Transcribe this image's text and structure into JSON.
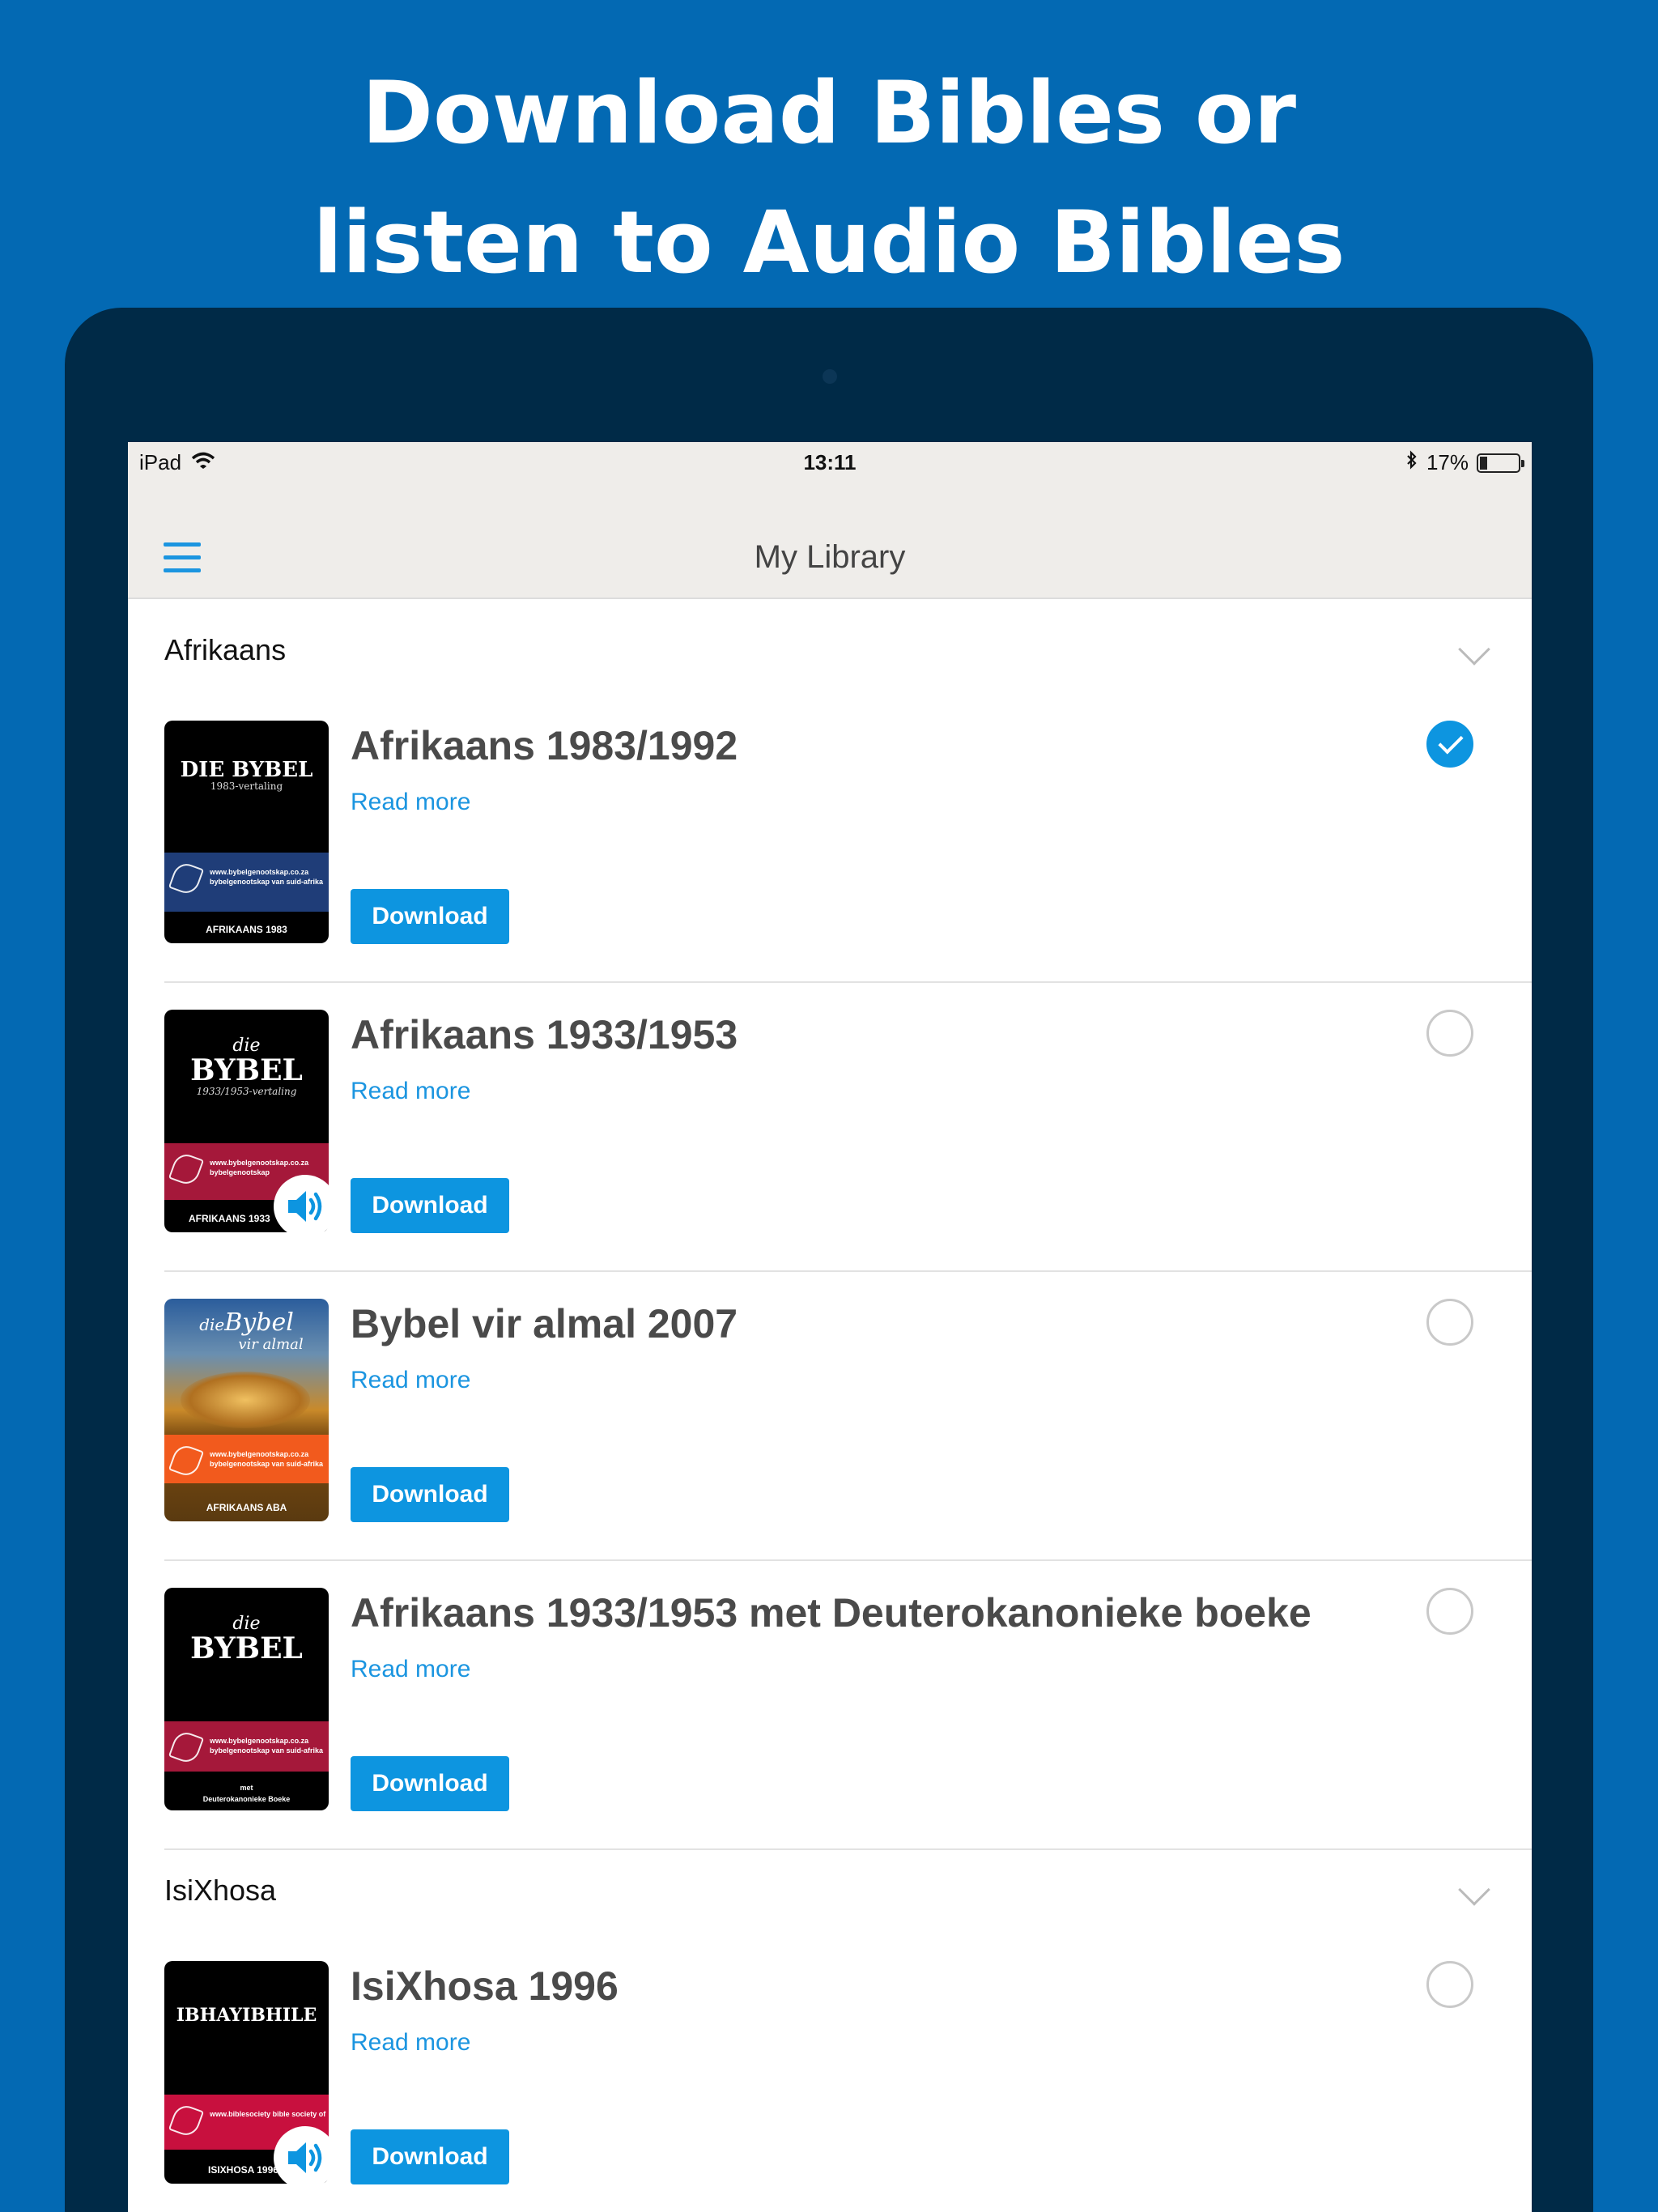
{
  "headline": {
    "line1": "Download Bibles or",
    "line2": "listen to Audio Bibles"
  },
  "status": {
    "device": "iPad",
    "time": "13:11",
    "battery": "17%",
    "battery_level": 0.17
  },
  "nav": {
    "title": "My Library"
  },
  "sections": [
    {
      "name": "Afrikaans",
      "items": [
        {
          "title": "Afrikaans 1983/1992",
          "read_more": "Read more",
          "download": "Download",
          "selected": true,
          "audio": false,
          "cover": {
            "title": "DIE BYBEL",
            "subtitle": "1983-vertaling",
            "url": "www.bybelgenootskap.co.za bybelgenootskap van suid-afrika",
            "label": "AFRIKAANS 1983",
            "band_color": "#1f3d78"
          }
        },
        {
          "title": "Afrikaans 1933/1953",
          "read_more": "Read more",
          "download": "Download",
          "selected": false,
          "audio": true,
          "cover": {
            "title_small": "die",
            "title": "BYBEL",
            "subtitle": "1933/1953-vertaling",
            "url": "www.bybelgenootskap.co.za bybelgenootskap",
            "label": "AFRIKAANS 1933",
            "band_color": "#a5183a"
          }
        },
        {
          "title": "Bybel vir almal 2007",
          "read_more": "Read more",
          "download": "Download",
          "selected": false,
          "audio": false,
          "cover": {
            "title_small": "die",
            "title": "Bybel",
            "subtitle": "vir almal",
            "url": "www.bybelgenootskap.co.za bybelgenootskap van suid-afrika",
            "label": "AFRIKAANS ABA",
            "band_color": "#f25a1d"
          }
        },
        {
          "title": "Afrikaans 1933/1953 met Deuterokanonieke boeke",
          "read_more": "Read more",
          "download": "Download",
          "selected": false,
          "audio": false,
          "cover": {
            "title_small": "die",
            "title": "BYBEL",
            "subtitle": "",
            "url": "www.bybelgenootskap.co.za bybelgenootskap van suid-afrika",
            "label_line1": "met",
            "label_line2": "Deuterokanonieke Boeke",
            "band_color": "#a5183a"
          }
        }
      ]
    },
    {
      "name": "IsiXhosa",
      "items": [
        {
          "title": "IsiXhosa 1996",
          "read_more": "Read more",
          "download": "Download",
          "selected": false,
          "audio": true,
          "cover": {
            "title": "IBHAYIBHILE",
            "url": "www.biblesociety bible society of",
            "label": "ISIXHOSA 1996",
            "band_color": "#c8103e"
          }
        }
      ]
    }
  ],
  "colors": {
    "background": "#0369b3",
    "device": "#002a47",
    "accent": "#0d95e0",
    "nav_bg": "#efedea"
  },
  "icons": {
    "menu": "hamburger-icon",
    "wifi": "wifi-icon",
    "bluetooth": "bluetooth-icon",
    "battery": "battery-icon",
    "chevron": "chevron-down-icon",
    "audio": "speaker-icon",
    "check": "check-icon"
  }
}
